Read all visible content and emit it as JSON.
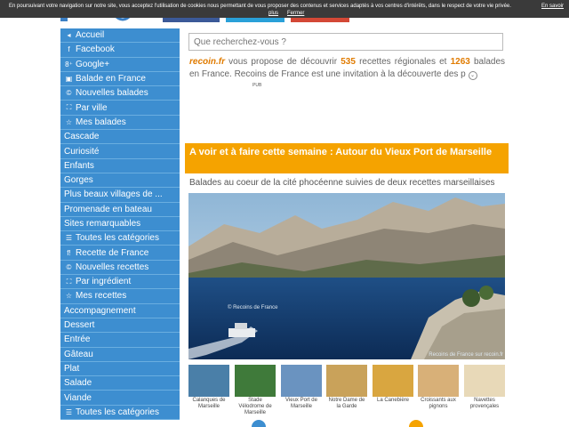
{
  "cookie": {
    "message": "En poursuivant votre navigation sur notre site, vous acceptez l'utilisation de cookies nous permettant de vous proposer des contenus et services adaptés à vos centres d'intérêts, dans le respect de votre vie privée.",
    "more_label": "En savoir",
    "more_label2": "plus",
    "close_label": "Fermer"
  },
  "sidebar": {
    "items": [
      {
        "icon": "◂",
        "label": "Accueil"
      },
      {
        "icon": "f",
        "label": "Facebook"
      },
      {
        "icon": "8⁺",
        "label": "Google+"
      },
      {
        "icon": "▣",
        "label": "Balade en France"
      },
      {
        "icon": "©",
        "label": "Nouvelles balades"
      },
      {
        "icon": "⛶",
        "label": "Par ville"
      },
      {
        "icon": "☆",
        "label": "Mes balades"
      },
      {
        "icon": "",
        "label": "Cascade"
      },
      {
        "icon": "",
        "label": "Curiosité"
      },
      {
        "icon": "",
        "label": "Enfants"
      },
      {
        "icon": "",
        "label": "Gorges"
      },
      {
        "icon": "",
        "label": "Plus beaux villages de ..."
      },
      {
        "icon": "",
        "label": "Promenade en bateau"
      },
      {
        "icon": "",
        "label": "Sites remarquables"
      },
      {
        "icon": "☰",
        "label": "Toutes les catégories"
      },
      {
        "icon": "f!",
        "label": "Recette de France"
      },
      {
        "icon": "©",
        "label": "Nouvelles recettes"
      },
      {
        "icon": "⛶",
        "label": "Par ingrédient"
      },
      {
        "icon": "☆",
        "label": "Mes recettes"
      },
      {
        "icon": "",
        "label": "Accompagnement"
      },
      {
        "icon": "",
        "label": "Dessert"
      },
      {
        "icon": "",
        "label": "Entrée"
      },
      {
        "icon": "",
        "label": "Gâteau"
      },
      {
        "icon": "",
        "label": "Plat"
      },
      {
        "icon": "",
        "label": "Salade"
      },
      {
        "icon": "",
        "label": "Viande"
      },
      {
        "icon": "☰",
        "label": "Toutes les catégories"
      }
    ]
  },
  "search": {
    "placeholder": "Que recherchez-vous ?"
  },
  "intro": {
    "brand": "recoin.fr",
    "part1": " vous propose de découvrir ",
    "balades_count": "535",
    "part2": " recettes régionales et ",
    "recettes_count": "1263",
    "part3": " balades en France. Recoins de France est une invitation à la découverte des p",
    "toggle": "⌄"
  },
  "pub_label": "PUB",
  "headline": "A voir et à faire cette semaine : Autour du Vieux Port de Marseille",
  "subtitle": "Balades au coeur de la cité phocéenne suivies de deux recettes marseillaises",
  "photo": {
    "watermark": "© Recoins de France",
    "credit": "Recoins de France sur recoin.fr"
  },
  "thumbs": [
    {
      "caption": "Calanques de Marseille",
      "color": "#4a7fa8"
    },
    {
      "caption": "Stade Vélodrome de Marseille",
      "color": "#3f7a3a"
    },
    {
      "caption": "Vieux Port de Marseille",
      "color": "#6a93c0"
    },
    {
      "caption": "Notre Dame de la Garde",
      "color": "#c9a25a"
    },
    {
      "caption": "La Canebière",
      "color": "#d9a640"
    },
    {
      "caption": "Croissants aux pignons",
      "color": "#d8b078"
    },
    {
      "caption": "Navettes provençales",
      "color": "#e8d9b8"
    }
  ],
  "colors": {
    "sidebar": "#3d8ed0",
    "accent": "#f5a300",
    "brand": "#e07b00"
  }
}
